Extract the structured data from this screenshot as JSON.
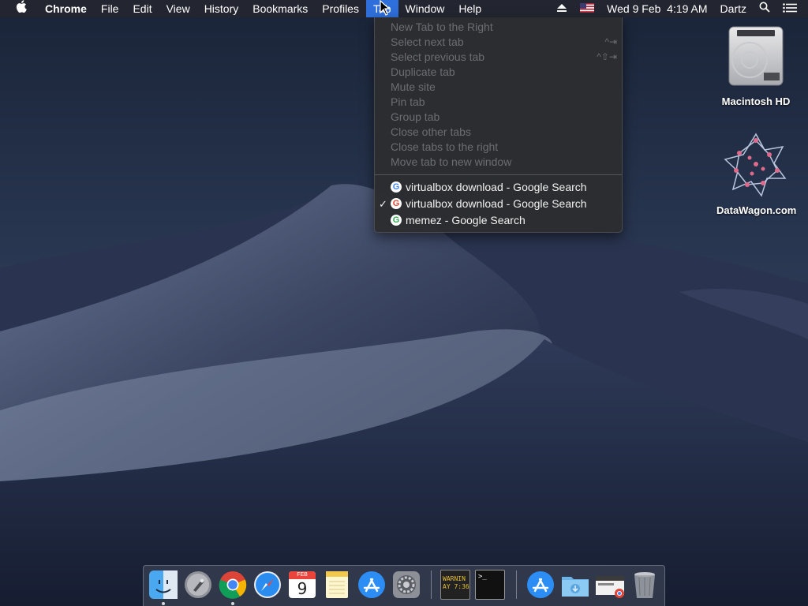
{
  "menubar": {
    "apple_icon": "apple-icon",
    "app_name": "Chrome",
    "menus": [
      "File",
      "Edit",
      "View",
      "History",
      "Bookmarks",
      "Profiles",
      "Tab",
      "Window",
      "Help"
    ],
    "active_menu": "Tab",
    "status": {
      "eject_icon": "eject-icon",
      "flag_icon": "us-flag-icon",
      "datetime": "Wed 9 Feb  4:19 AM",
      "user": "Dartz",
      "search_icon": "spotlight-search-icon",
      "list_icon": "notification-center-icon"
    }
  },
  "tab_menu": {
    "disabled_items": [
      {
        "label": "New Tab to the Right",
        "shortcut": ""
      },
      {
        "label": "Select next tab",
        "shortcut": "^⇥"
      },
      {
        "label": "Select previous tab",
        "shortcut": "^⇧⇥"
      },
      {
        "label": "Duplicate tab",
        "shortcut": ""
      },
      {
        "label": "Mute site",
        "shortcut": ""
      },
      {
        "label": "Pin tab",
        "shortcut": ""
      },
      {
        "label": "Group tab",
        "shortcut": ""
      },
      {
        "label": "Close other tabs",
        "shortcut": ""
      },
      {
        "label": "Close tabs to the right",
        "shortcut": ""
      },
      {
        "label": "Move tab to new window",
        "shortcut": ""
      }
    ],
    "tabs": [
      {
        "label": "virtualbox download - Google Search",
        "checked": false
      },
      {
        "label": "virtualbox download - Google Search",
        "checked": true
      },
      {
        "label": "memez - Google Search",
        "checked": false
      }
    ],
    "check_mark": "✓",
    "favicon": "google-favicon-icon"
  },
  "desktop": {
    "icons": [
      {
        "label": "Macintosh HD",
        "icon": "hard-drive-icon"
      },
      {
        "label": "DataWagon.com",
        "icon": "datawagon-logo-icon"
      }
    ]
  },
  "dock": {
    "apps": [
      {
        "name": "Finder",
        "icon": "finder-icon",
        "running": true
      },
      {
        "name": "Launchpad",
        "icon": "launchpad-icon",
        "running": false
      },
      {
        "name": "Google Chrome",
        "icon": "chrome-icon",
        "running": true
      },
      {
        "name": "Safari",
        "icon": "safari-icon",
        "running": false
      },
      {
        "name": "Calendar",
        "icon": "calendar-icon",
        "running": false,
        "month": "FEB",
        "day": "9"
      },
      {
        "name": "Notes",
        "icon": "notes-icon",
        "running": false
      },
      {
        "name": "App Store",
        "icon": "app-store-icon",
        "running": false
      },
      {
        "name": "System Preferences",
        "icon": "system-preferences-icon",
        "running": false
      },
      {
        "name": "Console",
        "icon": "console-icon",
        "running": false,
        "text": "WARNIN\nAY 7:36"
      },
      {
        "name": "Terminal",
        "icon": "terminal-icon",
        "running": false,
        "text": ">_"
      },
      {
        "name": "Applications",
        "icon": "applications-folder-icon",
        "running": false
      },
      {
        "name": "Downloads",
        "icon": "downloads-folder-icon",
        "running": false
      },
      {
        "name": "Chrome window",
        "icon": "chrome-window-icon",
        "running": false
      },
      {
        "name": "Trash",
        "icon": "trash-icon",
        "running": false
      }
    ]
  },
  "colors": {
    "menubar_bg": "#24263a",
    "menu_highlight": "#2f6fdb",
    "menu_bg": "#2c2d30",
    "menu_disabled_text": "#6c6d72"
  }
}
